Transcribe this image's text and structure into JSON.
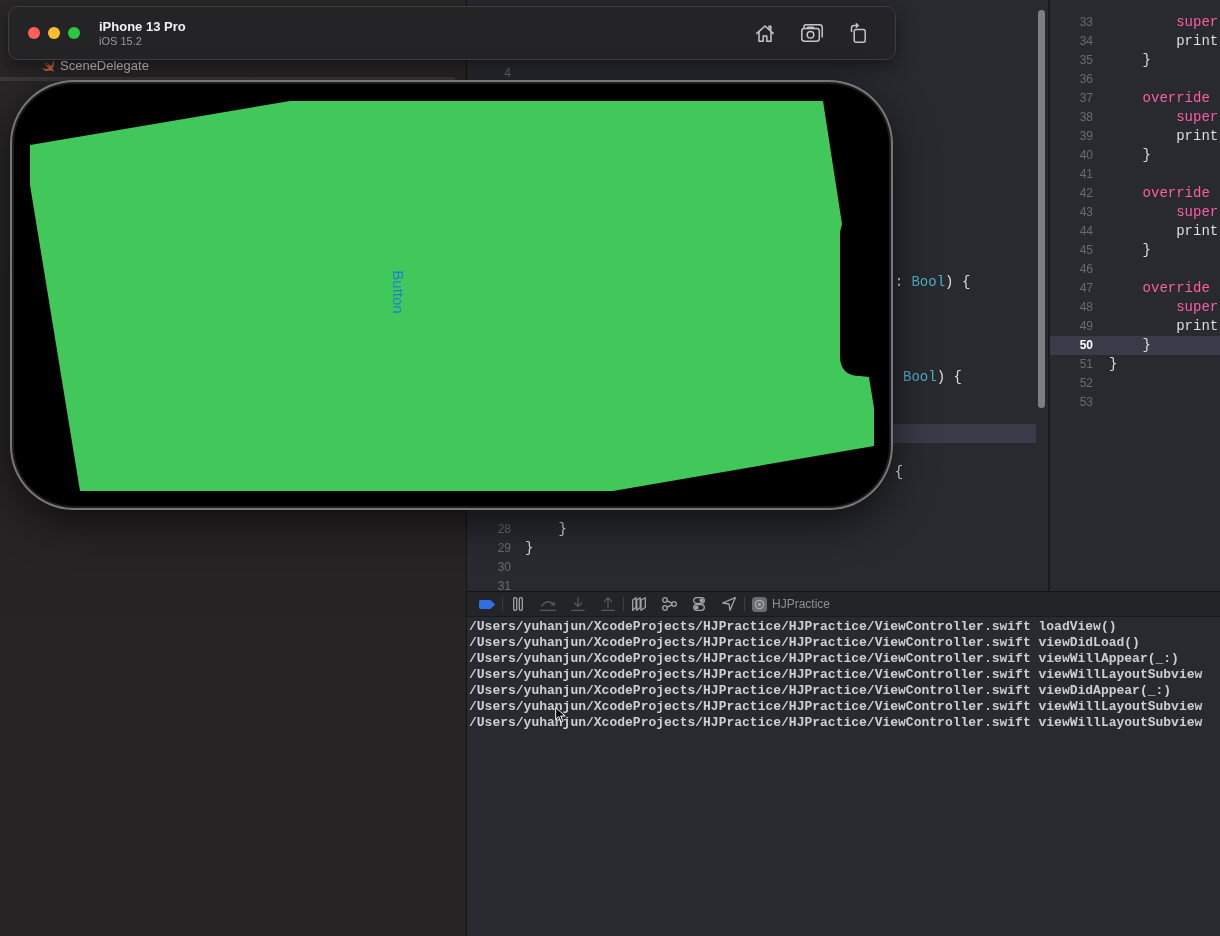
{
  "navigator": {
    "items": [
      {
        "label": "SceneDelegate",
        "selected": false
      },
      {
        "selected": true
      }
    ]
  },
  "simulator": {
    "device": "iPhone 13 Pro",
    "os": "iOS 15.2",
    "app_button": "Button"
  },
  "editors": [
    {
      "lines": [
        {
          "number": "4",
          "current": false
        },
        {
          "code": [
            {
              "kind": "plain",
              "text": ": "
            },
            {
              "kind": "type",
              "text": "Bool"
            },
            {
              "kind": "plain",
              "text": ") {"
            }
          ],
          "current": false
        },
        {
          "code": [
            {
              "kind": "type",
              "text": "Bool"
            },
            {
              "kind": "plain",
              "text": ") {"
            }
          ],
          "current": false
        },
        {
          "current": true
        },
        {
          "code": [
            {
              "kind": "plain",
              "text": "{"
            }
          ],
          "current": false
        },
        {
          "number": "28",
          "code": [
            {
              "kind": "plain",
              "text": "}"
            }
          ],
          "current": false
        },
        {
          "number": "29",
          "code": [
            {
              "kind": "plain",
              "text": "}"
            }
          ],
          "current": false
        },
        {
          "number": "30",
          "current": false
        },
        {
          "number": "31",
          "current": false
        }
      ]
    },
    {
      "lines": [
        {
          "number": "33",
          "code": [
            {
              "kind": "keyword",
              "text": "super"
            }
          ],
          "current": false
        },
        {
          "number": "34",
          "code": [
            {
              "kind": "plain",
              "text": "print"
            }
          ],
          "current": false
        },
        {
          "number": "35",
          "code": [
            {
              "kind": "plain",
              "text": "}"
            }
          ],
          "current": false
        },
        {
          "number": "36",
          "current": false
        },
        {
          "number": "37",
          "code": [
            {
              "kind": "keyword",
              "text": "override"
            }
          ],
          "current": false
        },
        {
          "number": "38",
          "code": [
            {
              "kind": "keyword",
              "text": "super"
            }
          ],
          "current": false
        },
        {
          "number": "39",
          "code": [
            {
              "kind": "plain",
              "text": "print"
            }
          ],
          "current": false
        },
        {
          "number": "40",
          "code": [
            {
              "kind": "plain",
              "text": "}"
            }
          ],
          "current": false
        },
        {
          "number": "41",
          "current": false
        },
        {
          "number": "42",
          "code": [
            {
              "kind": "keyword",
              "text": "override"
            }
          ],
          "current": false
        },
        {
          "number": "43",
          "code": [
            {
              "kind": "keyword",
              "text": "super"
            }
          ],
          "current": false
        },
        {
          "number": "44",
          "code": [
            {
              "kind": "plain",
              "text": "print"
            }
          ],
          "current": false
        },
        {
          "number": "45",
          "code": [
            {
              "kind": "plain",
              "text": "}"
            }
          ],
          "current": false
        },
        {
          "number": "46",
          "current": false
        },
        {
          "number": "47",
          "code": [
            {
              "kind": "keyword",
              "text": "override"
            }
          ],
          "current": false
        },
        {
          "number": "48",
          "code": [
            {
              "kind": "keyword",
              "text": "super"
            }
          ],
          "current": false
        },
        {
          "number": "49",
          "code": [
            {
              "kind": "plain",
              "text": "print"
            }
          ],
          "current": false
        },
        {
          "number": "50",
          "code": [
            {
              "kind": "plain",
              "text": "}"
            }
          ],
          "current": true
        },
        {
          "number": "51",
          "code": [
            {
              "kind": "plain",
              "text": "}"
            }
          ],
          "current": false
        },
        {
          "number": "52",
          "current": false
        },
        {
          "number": "53",
          "current": false
        }
      ]
    }
  ],
  "console": {
    "breakpoints_active": true,
    "controls": [
      {
        "kind": "pause",
        "disabled": false
      },
      {
        "kind": "step_over",
        "disabled": true
      },
      {
        "kind": "step_into",
        "disabled": true
      },
      {
        "kind": "step_out",
        "disabled": true
      },
      {
        "kind": "view_debugger",
        "disabled": false
      },
      {
        "kind": "memory_graph",
        "disabled": false
      },
      {
        "kind": "environment",
        "disabled": false
      },
      {
        "kind": "location",
        "disabled": false
      }
    ],
    "target": "HJPractice",
    "output": [
      "/Users/yuhanjun/XcodeProjects/HJPractice/HJPractice/ViewController.swift loadView()",
      "/Users/yuhanjun/XcodeProjects/HJPractice/HJPractice/ViewController.swift viewDidLoad()",
      "/Users/yuhanjun/XcodeProjects/HJPractice/HJPractice/ViewController.swift viewWillAppear(_:)",
      "/Users/yuhanjun/XcodeProjects/HJPractice/HJPractice/ViewController.swift viewWillLayoutSubview",
      "/Users/yuhanjun/XcodeProjects/HJPractice/HJPractice/ViewController.swift viewDidAppear(_:)",
      "/Users/yuhanjun/XcodeProjects/HJPractice/HJPractice/ViewController.swift viewWillLayoutSubview",
      "/Users/yuhanjun/XcodeProjects/HJPractice/HJPractice/ViewController.swift viewWillLayoutSubview"
    ]
  }
}
